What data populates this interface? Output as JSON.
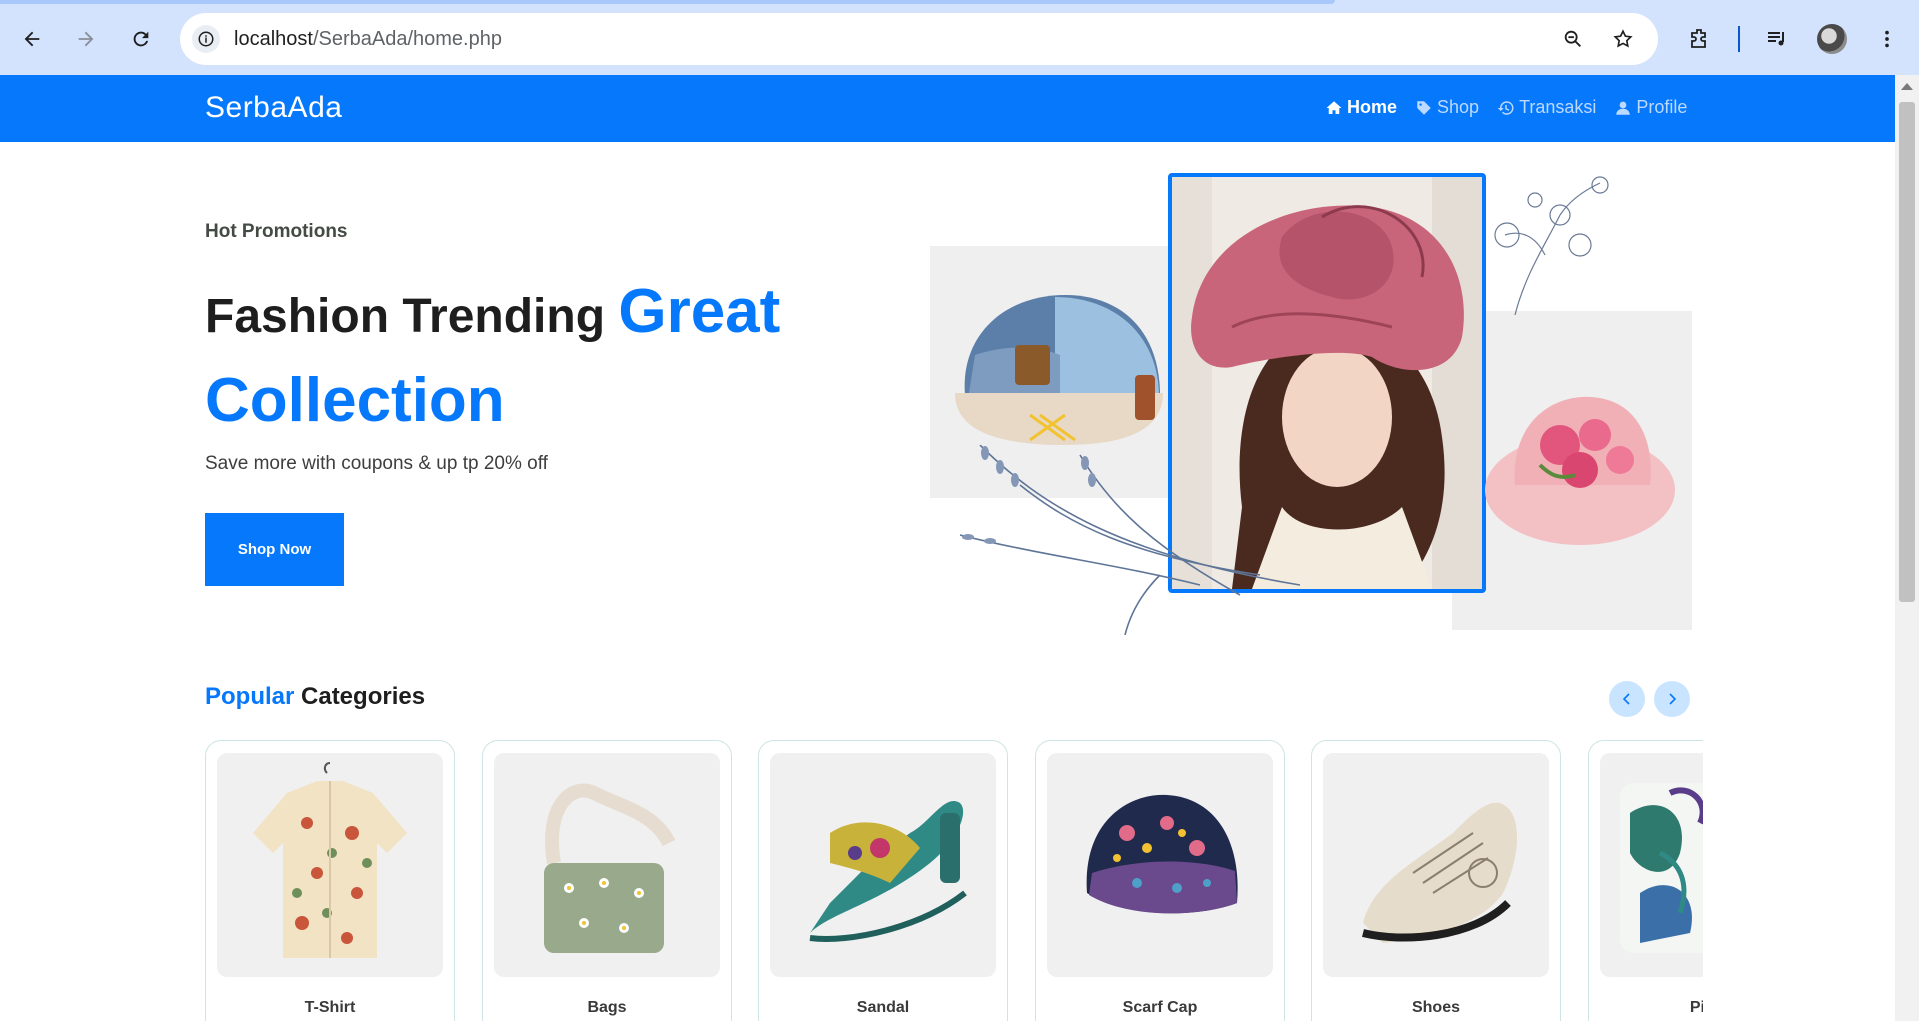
{
  "browser": {
    "url_host": "localhost",
    "url_path": "/SerbaAda/home.php"
  },
  "navbar": {
    "logo": "SerbaAda",
    "links": [
      {
        "label": "Home",
        "icon": "home-icon",
        "active": true
      },
      {
        "label": "Shop",
        "icon": "tag-icon",
        "active": false
      },
      {
        "label": "Transaksi",
        "icon": "history-icon",
        "active": false
      },
      {
        "label": "Profile",
        "icon": "user-icon",
        "active": false
      }
    ]
  },
  "hero": {
    "subtitle": "Hot Promotions",
    "title_plain": "Fashion Trending ",
    "title_accent_1": "Great",
    "title_accent_2": "Collection",
    "description": "Save more with coupons & up tp 20% off",
    "cta": "Shop Now"
  },
  "categories": {
    "heading_accent": "Popular",
    "heading_rest": " Categories",
    "items": [
      {
        "label": "T-Shirt"
      },
      {
        "label": "Bags"
      },
      {
        "label": "Sandal"
      },
      {
        "label": "Scarf Cap"
      },
      {
        "label": "Shoes"
      },
      {
        "label": "Pillow"
      }
    ]
  },
  "colors": {
    "brand": "#0578fc",
    "chrome": "#d3e3fd"
  }
}
